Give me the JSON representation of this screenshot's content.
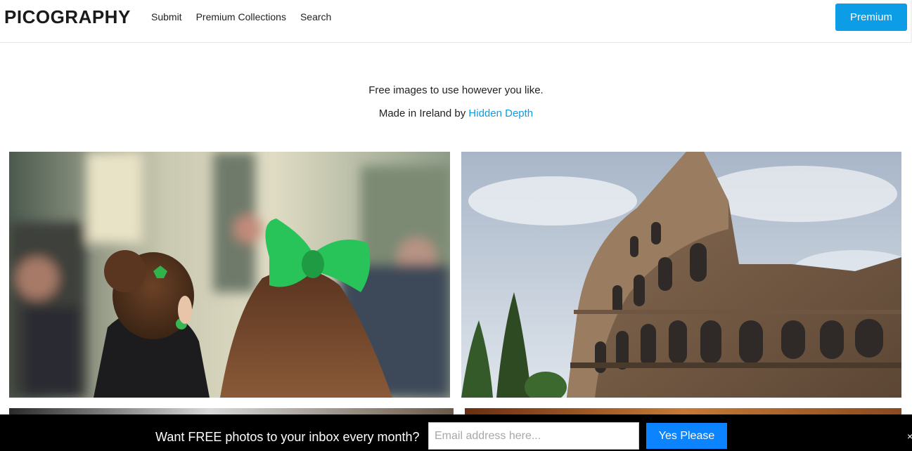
{
  "header": {
    "logo": "PICOGRAPHY",
    "nav": [
      "Submit",
      "Premium Collections",
      "Search"
    ],
    "premium_label": "Premium"
  },
  "intro": {
    "line1": "Free images to use however you like.",
    "line2_prefix": "Made in Ireland by ",
    "line2_link": "Hidden Depth"
  },
  "newsletter": {
    "message": "Want FREE photos to your inbox every month?",
    "email_placeholder": "Email address here...",
    "submit_label": "Yes Please",
    "close_glyph": "×"
  },
  "colors": {
    "accent": "#0d9ce6",
    "submit": "#0d84ff",
    "banner_bg": "#000000"
  }
}
